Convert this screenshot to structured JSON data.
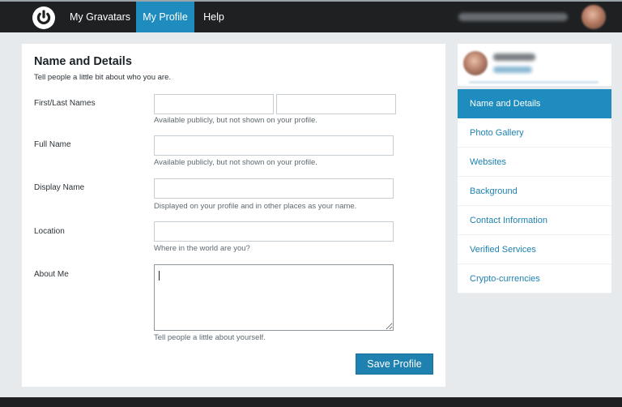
{
  "nav": {
    "logo_icon": "gravatar-power-icon",
    "items": [
      "My Gravatars",
      "My Profile",
      "Help"
    ],
    "active": "My Profile"
  },
  "colors": {
    "accent": "#1e8cbe",
    "topbar": "#1e2022",
    "link": "#1e81b0"
  },
  "form": {
    "title": "Name and Details",
    "subtitle": "Tell people a little bit about who you are.",
    "fields": {
      "names": {
        "label": "First/Last Names",
        "first_value": "",
        "last_value": "",
        "hint": "Available publicly, but not shown on your profile."
      },
      "full_name": {
        "label": "Full Name",
        "value": "",
        "hint": "Available publicly, but not shown on your profile."
      },
      "display_name": {
        "label": "Display Name",
        "value": "",
        "hint": "Displayed on your profile and in other places as your name."
      },
      "location": {
        "label": "Location",
        "value": "",
        "hint": "Where in the world are you?"
      },
      "about_me": {
        "label": "About Me",
        "value": "",
        "hint": "Tell people a little about yourself."
      }
    },
    "save_label": "Save Profile"
  },
  "sidebar": {
    "menu": [
      {
        "label": "Name and Details",
        "active": true
      },
      {
        "label": "Photo Gallery",
        "active": false
      },
      {
        "label": "Websites",
        "active": false
      },
      {
        "label": "Background",
        "active": false
      },
      {
        "label": "Contact Information",
        "active": false
      },
      {
        "label": "Verified Services",
        "active": false
      },
      {
        "label": "Crypto-currencies",
        "active": false
      }
    ]
  }
}
